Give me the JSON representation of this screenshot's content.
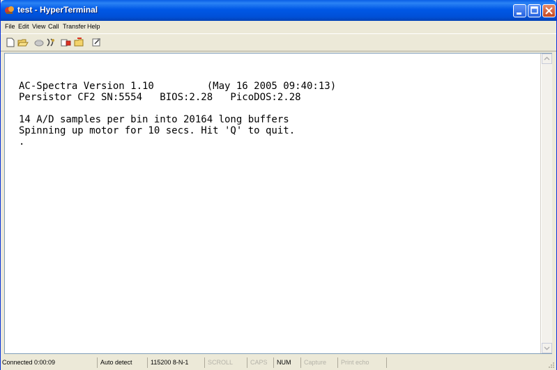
{
  "window": {
    "title": "test - HyperTerminal"
  },
  "menu": {
    "file": "File",
    "edit": "Edit",
    "view": "View",
    "call": "Call",
    "transfer": "Transfer",
    "help": "Help"
  },
  "toolbar": {
    "icons": [
      "new-file-icon",
      "open-folder-icon",
      "call-icon",
      "disconnect-icon",
      "send-icon",
      "receive-icon",
      "properties-icon"
    ]
  },
  "terminal": {
    "lines": [
      "AC-Spectra Version 1.10         (May 16 2005 09:40:13)",
      "Persistor CF2 SN:5554   BIOS:2.28   PicoDOS:2.28",
      "",
      "14 A/D samples per bin into 20164 long buffers",
      "Spinning up motor for 10 secs. Hit 'Q' to quit.",
      "."
    ]
  },
  "status": {
    "connected": "Connected 0:00:09",
    "detect": "Auto detect",
    "params": "115200 8-N-1",
    "scroll": "SCROLL",
    "caps": "CAPS",
    "num": "NUM",
    "capture": "Capture",
    "print_echo": "Print echo"
  },
  "colors": {
    "title_bar": "#0054e3",
    "terminal_bg": "#ffffff",
    "terminal_fg": "#000000"
  }
}
